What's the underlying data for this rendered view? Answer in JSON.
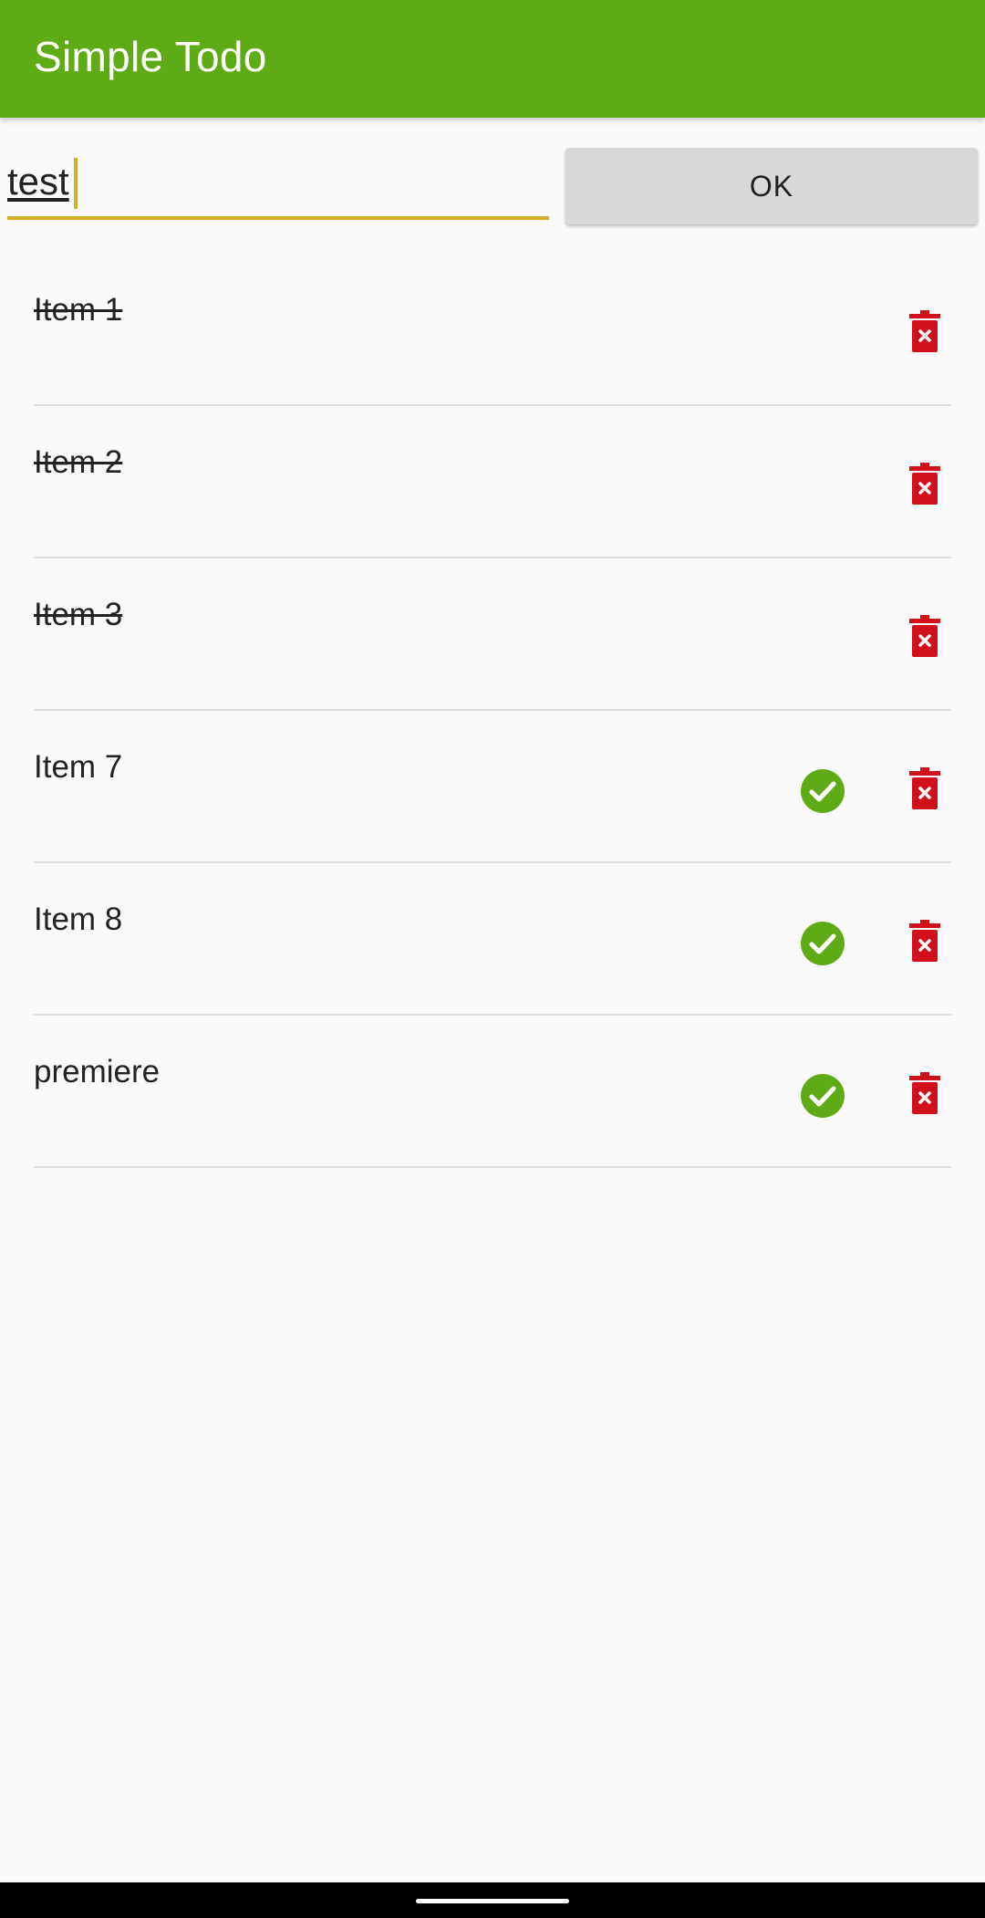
{
  "app": {
    "title": "Simple Todo"
  },
  "input": {
    "value": "test",
    "placeholder": ""
  },
  "ok_button": {
    "label": "OK"
  },
  "items": [
    {
      "label": "Item 1",
      "done": true
    },
    {
      "label": "Item 2",
      "done": true
    },
    {
      "label": "Item 3",
      "done": true
    },
    {
      "label": "Item 7",
      "done": false
    },
    {
      "label": "Item 8",
      "done": false
    },
    {
      "label": "premiere",
      "done": false
    }
  ],
  "colors": {
    "toolbar": "#5fab15",
    "accent": "#d4b02a",
    "done_icon": "#5fab15",
    "delete_icon": "#d0101a"
  },
  "icons": {
    "done": "check-circle-icon",
    "delete": "trash-delete-icon"
  }
}
